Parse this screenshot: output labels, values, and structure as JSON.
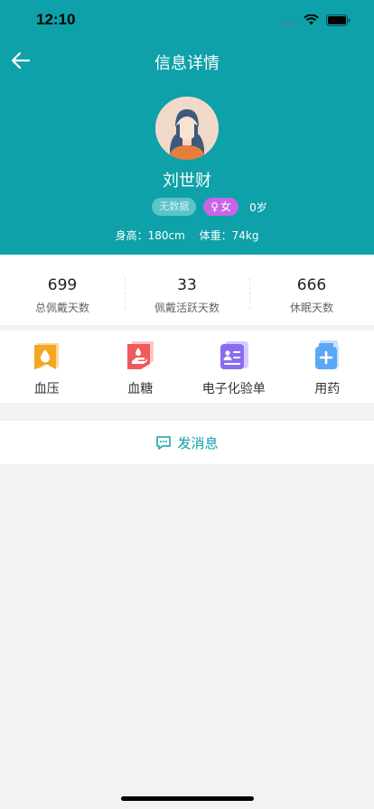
{
  "status": {
    "time": "12:10"
  },
  "nav": {
    "title": "信息详情",
    "back_icon": "arrow-left-icon"
  },
  "profile": {
    "name": "刘世财",
    "tag_nodata": "无数据",
    "gender_symbol": "♀",
    "gender": "女",
    "age": "0岁",
    "height": "身高：180cm",
    "weight": "体重：74kg"
  },
  "stats": [
    {
      "value": "699",
      "label": "总佩戴天数"
    },
    {
      "value": "33",
      "label": "佩戴活跃天数"
    },
    {
      "value": "666",
      "label": "休眠天数"
    }
  ],
  "menu": [
    {
      "label": "血压",
      "icon": "blood-drop-icon",
      "color": "#f5a623"
    },
    {
      "label": "血糖",
      "icon": "glucose-hand-icon",
      "color": "#f05a5a"
    },
    {
      "label": "电子化验单",
      "icon": "lab-report-icon",
      "color": "#8b6cf0"
    },
    {
      "label": "用药",
      "icon": "medicine-bottle-icon",
      "color": "#5aa7f5"
    }
  ],
  "send": {
    "label": "发消息",
    "icon": "chat-icon"
  },
  "colors": {
    "primary": "#0ea1a9",
    "background": "#f1f2f2",
    "gender_tag": "#c964e6"
  }
}
